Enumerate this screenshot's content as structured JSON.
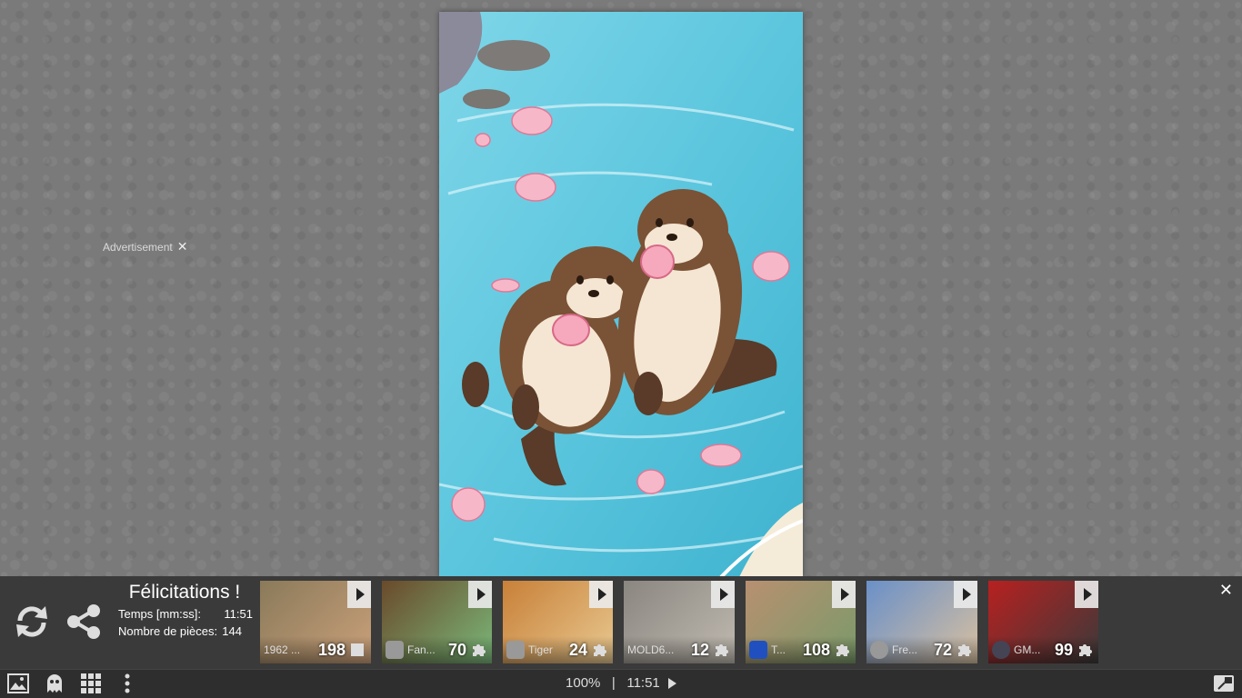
{
  "advertisement": {
    "label": "Advertisement",
    "close": "✕"
  },
  "congrats": {
    "title": "Félicitations !",
    "time_label": "Temps [mm:ss]:",
    "time_value": "11:51",
    "pieces_label": "Nombre de pièces:",
    "pieces_value": "144"
  },
  "thumbnails": [
    {
      "name": "1962 ...",
      "count": "198",
      "icon": "square-piece-icon",
      "colors": [
        "#8a7a5a",
        "#caa07a"
      ]
    },
    {
      "name": "Fan...",
      "count": "70",
      "icon": "puzzle-piece-icon",
      "colors": [
        "#6a4a2a",
        "#7ab87a"
      ]
    },
    {
      "name": "Tiger",
      "count": "24",
      "icon": "puzzle-piece-icon",
      "colors": [
        "#c88038",
        "#e8c890"
      ]
    },
    {
      "name": "MOLD6...",
      "count": "12",
      "icon": "puzzle-piece-icon",
      "colors": [
        "#8a8680",
        "#c0bab0"
      ]
    },
    {
      "name": "T...",
      "count": "108",
      "icon": "puzzle-piece-icon",
      "colors": [
        "#b89070",
        "#7a9a6a"
      ]
    },
    {
      "name": "Fre...",
      "count": "72",
      "icon": "puzzle-piece-icon",
      "colors": [
        "#6a90c8",
        "#d8c0a0"
      ]
    },
    {
      "name": "GM...",
      "count": "99",
      "icon": "puzzle-piece-icon",
      "colors": [
        "#b82020",
        "#3a3a3a"
      ]
    }
  ],
  "bar_close": "✕",
  "toolbar": {
    "zoom": "100%",
    "separator": "|",
    "time": "11:51"
  },
  "colors": {
    "bar_bg": "#3a3a3a",
    "toolbar_bg": "#2e2e2e",
    "water": "#5ec8dc"
  }
}
